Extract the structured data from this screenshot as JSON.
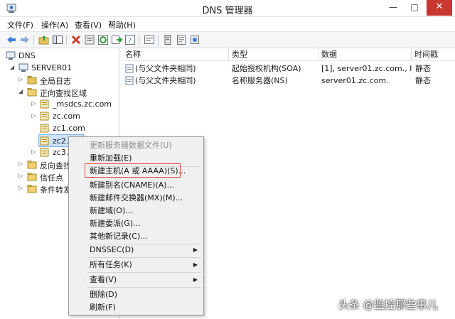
{
  "window": {
    "title": "DNS 管理器",
    "minimize": "—",
    "maximize": "□",
    "close": "✕"
  },
  "menubar": [
    "文件(F)",
    "操作(A)",
    "查看(V)",
    "帮助(H)"
  ],
  "toolbar_icons": [
    "back-icon",
    "forward-icon",
    "up-folder-icon",
    "show-tree-icon",
    "delete-icon",
    "properties-icon",
    "refresh-icon",
    "export-icon",
    "help-icon",
    "console-icon",
    "server-list-icon",
    "record-icon"
  ],
  "tree": {
    "root": "DNS",
    "server": "SERVER01",
    "global_log": "全局日志",
    "forward_zone": "正向查找区域",
    "zones": [
      "_msdcs.zc.com",
      "zc.com",
      "zc1.com",
      "zc2.c...",
      "zc3.c"
    ],
    "reverse_zone": "反向查找",
    "trust_points": "信任点",
    "conditional_forwarders": "条件转发"
  },
  "list": {
    "columns": [
      "名称",
      "类型",
      "数据",
      "时间戳"
    ],
    "rows": [
      {
        "name": "(与父文件夹相同)",
        "type": "起始授权机构(SOA)",
        "data": "[1], server01.zc.com., h...",
        "timestamp": "静态"
      },
      {
        "name": "(与父文件夹相同)",
        "type": "名称服务器(NS)",
        "data": "server01.zc.com.",
        "timestamp": "静态"
      }
    ]
  },
  "context_menu": {
    "items": [
      {
        "label": "更新服务器数据文件(U)",
        "disabled": true
      },
      {
        "label": "重新加载(E)"
      },
      {
        "label": "新建主机(A 或 AAAA)(S)..."
      },
      {
        "label": "新建别名(CNAME)(A)..."
      },
      {
        "label": "新建邮件交换器(MX)(M)..."
      },
      {
        "label": "新建域(O)..."
      },
      {
        "label": "新建委派(G)..."
      },
      {
        "label": "其他新记录(C)..."
      },
      {
        "label": "DNSSEC(D)",
        "submenu": true
      },
      {
        "label": "所有任务(K)",
        "submenu": true
      },
      {
        "label": "查看(V)",
        "submenu": true
      },
      {
        "label": "删除(D)"
      },
      {
        "label": "刷新(F)"
      }
    ],
    "highlighted_index": 2
  },
  "watermark": "头条 @监控那些事儿",
  "colors": {
    "accent": "#3b7dd8",
    "highlight": "#e0443a",
    "selection": "#cde3f7",
    "close_button": "#c7372f"
  }
}
